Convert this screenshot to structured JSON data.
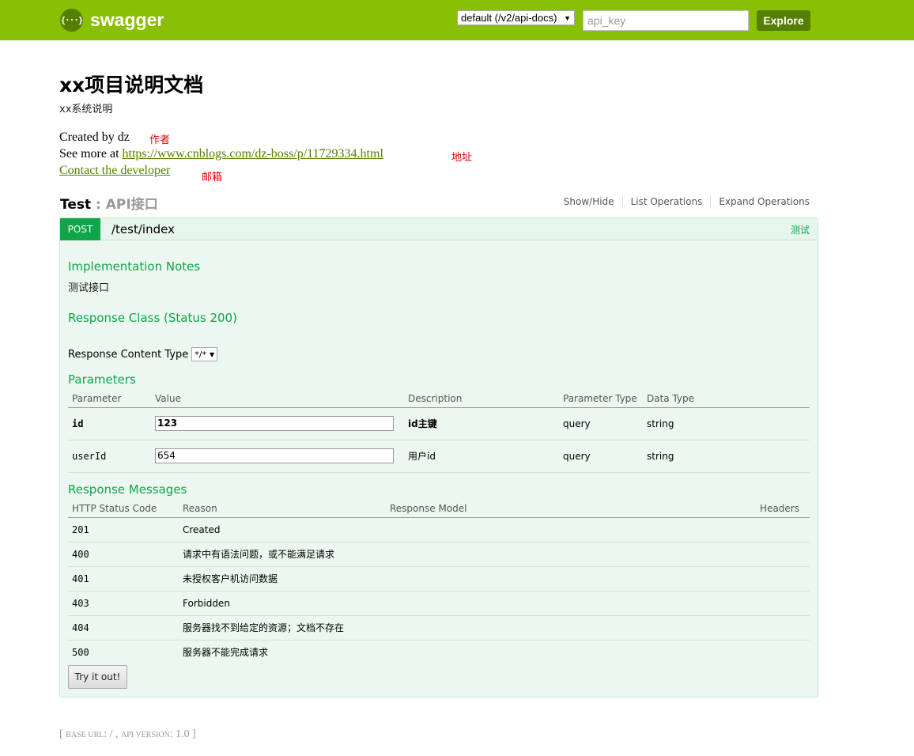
{
  "header": {
    "logo_icon": "{···}",
    "logo_text": "swagger",
    "spec_select": "default (/v2/api-docs)",
    "api_key_placeholder": "api_key",
    "explore_label": "Explore"
  },
  "info": {
    "title": "xx项目说明文档",
    "description": "xx系统说明",
    "created_by": "Created by dz",
    "see_more_prefix": "See more at ",
    "see_more_link": "https://www.cnblogs.com/dz-boss/p/11729334.html",
    "contact": "Contact the developer",
    "notes": {
      "author": "作者",
      "address": "地址",
      "email": "邮箱"
    }
  },
  "resource": {
    "name": "Test",
    "separator": " : ",
    "description": "API接口",
    "ops": [
      "Show/Hide",
      "List Operations",
      "Expand Operations"
    ]
  },
  "operation": {
    "method": "POST",
    "path": "/test/index",
    "summary": "测试",
    "impl_notes_heading": "Implementation Notes",
    "impl_notes_text": "测试接口",
    "response_class_heading": "Response Class (Status 200)",
    "content_type_label": "Response Content Type",
    "content_type_value": "*/*",
    "parameters_heading": "Parameters",
    "param_columns": [
      "Parameter",
      "Value",
      "Description",
      "Parameter Type",
      "Data Type"
    ],
    "params": [
      {
        "name": "id",
        "value": "123",
        "description": "id主键",
        "param_type": "query",
        "data_type": "string"
      },
      {
        "name": "userId",
        "value": "654",
        "description": "用户id",
        "param_type": "query",
        "data_type": "string"
      }
    ],
    "response_messages_heading": "Response Messages",
    "rm_columns": [
      "HTTP Status Code",
      "Reason",
      "Response Model",
      "Headers"
    ],
    "responses": [
      {
        "code": "201",
        "reason": "Created"
      },
      {
        "code": "400",
        "reason": "请求中有语法问题，或不能满足请求"
      },
      {
        "code": "401",
        "reason": "未授权客户机访问数据"
      },
      {
        "code": "403",
        "reason": "Forbidden"
      },
      {
        "code": "404",
        "reason": "服务器找不到给定的资源；文档不存在"
      },
      {
        "code": "500",
        "reason": "服务器不能完成请求"
      }
    ],
    "try_label": "Try it out!"
  },
  "footer": {
    "open": "[ ",
    "base_url_label": "base url",
    "base_url": ": / , ",
    "api_version_label": "api version",
    "api_version": ": 1.0 ]"
  },
  "colors": {
    "header_bg": "#89bf04",
    "explore_bg": "#547f00",
    "post_green": "#10a54a",
    "note_red": "#e00000"
  }
}
